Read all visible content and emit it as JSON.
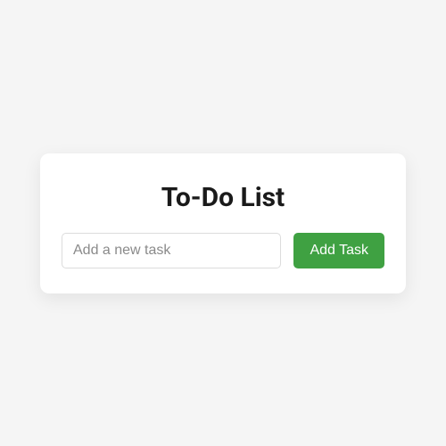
{
  "card": {
    "title": "To-Do List",
    "input": {
      "placeholder": "Add a new task",
      "value": ""
    },
    "addButton": {
      "label": "Add Task"
    }
  }
}
